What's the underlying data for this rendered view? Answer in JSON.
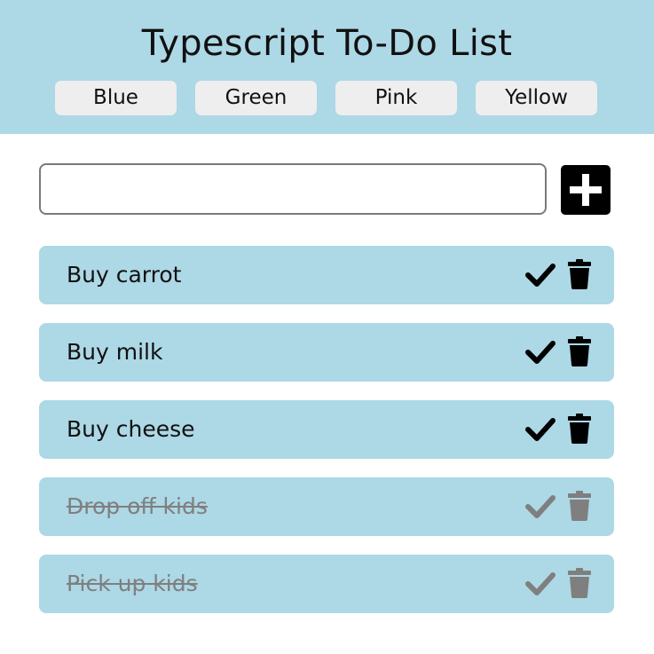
{
  "header": {
    "title": "Typescript To-Do List",
    "themes": [
      "Blue",
      "Green",
      "Pink",
      "Yellow"
    ]
  },
  "new_todo": {
    "value": "",
    "placeholder": ""
  },
  "add_button_icon": "plus-icon",
  "todos": [
    {
      "label": "Buy carrot",
      "completed": false
    },
    {
      "label": "Buy milk",
      "completed": false
    },
    {
      "label": "Buy cheese",
      "completed": false
    },
    {
      "label": "Drop off kids",
      "completed": true
    },
    {
      "label": "Pick up kids",
      "completed": true
    }
  ],
  "colors": {
    "accent": "#add8e6",
    "button_bg": "#eeeeee",
    "active_icon": "#000000",
    "completed": "#7f7f7f"
  }
}
